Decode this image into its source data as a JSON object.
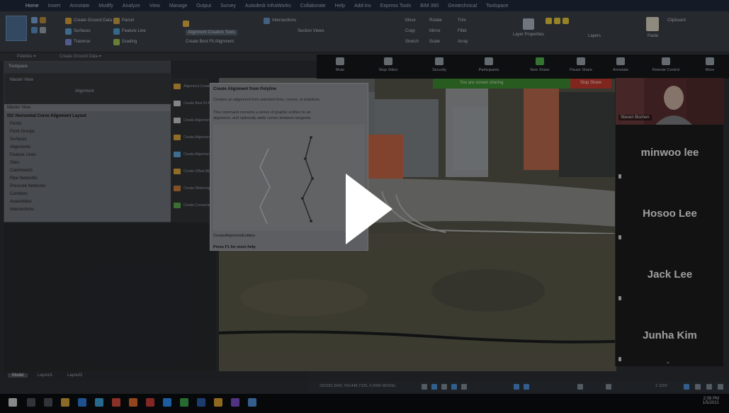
{
  "ribbon": {
    "tabs": [
      "Home",
      "Insert",
      "Annotate",
      "Modify",
      "Analyze",
      "View",
      "Manage",
      "Output",
      "Survey",
      "Autodesk InfraWorks",
      "Collaborate",
      "Help",
      "Add-ins",
      "Express Tools",
      "BIM 360",
      "Geotechnical",
      "Toolspace"
    ],
    "items": {
      "palettes": "Palettes",
      "create_ground_data": "Create Ground Data",
      "profile": "Profile",
      "surfaces": "Surfaces",
      "traverse": "Traverse",
      "parcel": "Parcel",
      "feature_line": "Feature Line",
      "grading": "Grading",
      "alignment_creation_tools": "Alignment Creation Tools",
      "create_best_fit_alignment": "Create Best Fit Alignment",
      "intersections": "Intersections",
      "section_views": "Section Views",
      "move": "Move",
      "rotate": "Rotate",
      "trim": "Trim",
      "copy": "Copy",
      "mirror": "Mirror",
      "fillet": "Fillet",
      "stretch": "Stretch",
      "scale": "Scale",
      "array": "Array",
      "layer_properties": "Layer Properties",
      "layers": "Layers",
      "paste": "Paste",
      "clipboard": "Clipboard"
    },
    "panels": [
      "Palettes ▾",
      "Create Ground Data ▾"
    ]
  },
  "toolspace": {
    "header": "Toolspace",
    "master_view": "Master View",
    "view_label": "Alignment",
    "tree": [
      "ISC Horizontal Curve Alignment Layout",
      "Points",
      "Point Groups",
      "Surfaces",
      "Alignments",
      "Feature Lines",
      "Sites",
      "Catchments",
      "Pipe Networks",
      "Pressure Networks",
      "Corridors",
      "Assemblies",
      "Intersections"
    ]
  },
  "palette": [
    "Alignment Creation Tools",
    "Create Best Fit Alignment",
    "Create Alignment from Corridor",
    "Create Alignment from Objects",
    "Create Alignment from Network",
    "Create Offset Alignment",
    "Create Widening",
    "Create Connected Alignment"
  ],
  "tooltip": {
    "title": "Create Alignment from Polyline",
    "lines": [
      "Creates an alignment from selected lines, curves, or polylines.",
      "",
      "This command converts a series of graphic entities to an",
      "alignment, and optionally adds curves between tangents."
    ],
    "command": "CreateAlignmentEntities",
    "footer": "Press F1 for more help"
  },
  "zoom": {
    "toolbar": [
      "Mute",
      "Stop Video",
      "Security",
      "Participants",
      "New Share",
      "Pause Share",
      "Annotate",
      "Remote Control",
      "More"
    ],
    "participant_count": "5",
    "status": "You are screen sharing",
    "stop_share": "Stop Share",
    "participants": [
      "minwoo lee",
      "Hosoo Lee",
      "Jack Lee",
      "Junha Kim"
    ],
    "video_name": "Steven Bochen"
  },
  "layout_tabs": [
    "Model",
    "Layout1",
    "Layout2"
  ],
  "statusbar": {
    "coords": "331092.3042, 551448.7339, 0.0000  MODEL",
    "scale": "1:1000"
  },
  "taskbar": {
    "time": "2:08 PM",
    "date": "1/5/2021"
  },
  "colors": {
    "zoom_green": "#3d8a2f",
    "stop_red": "#c23a2e",
    "ribbon_active": "#4e6f95"
  }
}
